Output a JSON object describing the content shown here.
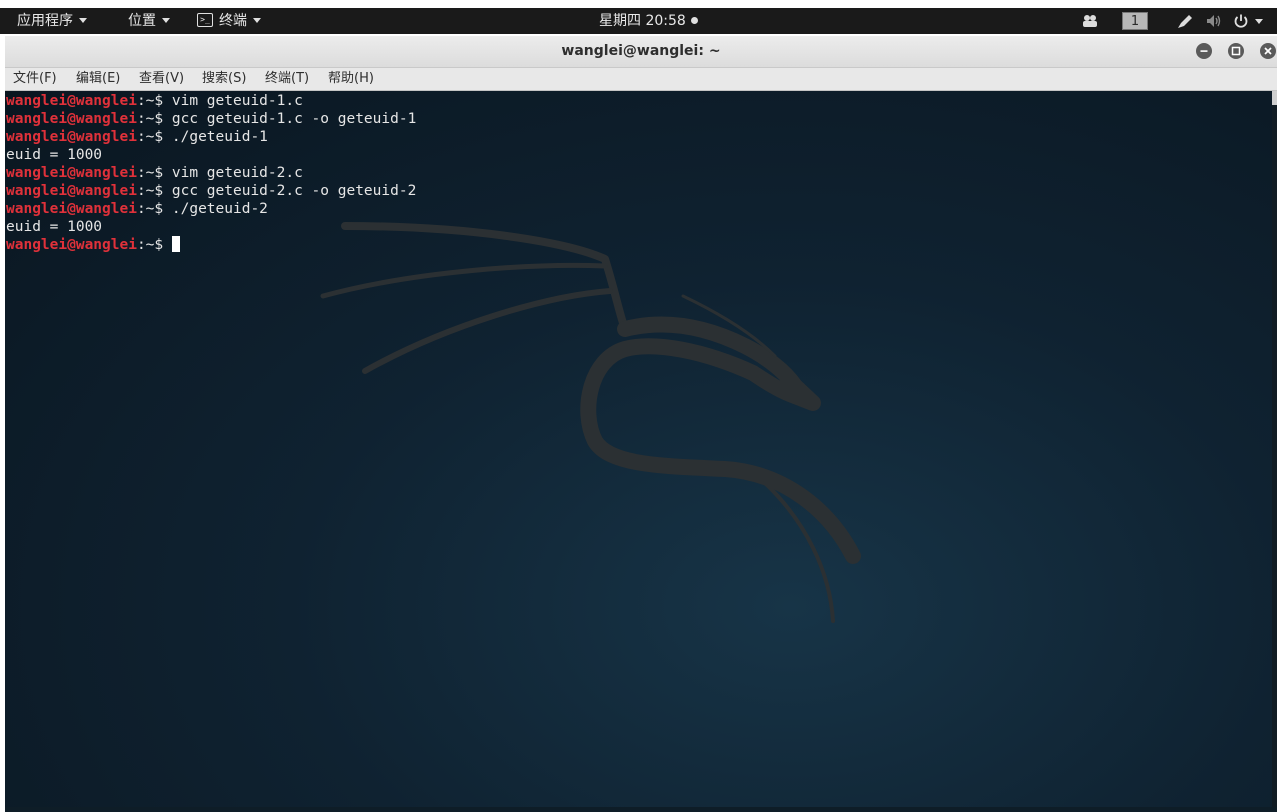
{
  "topbar": {
    "apps_label": "应用程序",
    "places_label": "位置",
    "terminal_label": "终端",
    "clock": "星期四 20:58",
    "workspace": "1"
  },
  "window": {
    "title": "wanglei@wanglei: ~",
    "menu": [
      "文件(F)",
      "编辑(E)",
      "查看(V)",
      "搜索(S)",
      "终端(T)",
      "帮助(H)"
    ]
  },
  "terminal": {
    "prompt_user": "wanglei@wanglei",
    "prompt_suffix": ":~$ ",
    "lines": [
      {
        "type": "prompt",
        "cmd": "vim geteuid-1.c"
      },
      {
        "type": "prompt",
        "cmd": "gcc geteuid-1.c -o geteuid-1"
      },
      {
        "type": "prompt",
        "cmd": "./geteuid-1"
      },
      {
        "type": "output",
        "text": "euid = 1000"
      },
      {
        "type": "prompt",
        "cmd": "vim geteuid-2.c"
      },
      {
        "type": "prompt",
        "cmd": "gcc geteuid-2.c -o geteuid-2"
      },
      {
        "type": "prompt",
        "cmd": "./geteuid-2"
      },
      {
        "type": "output",
        "text": "euid = 1000"
      },
      {
        "type": "prompt",
        "cmd": ""
      }
    ]
  },
  "colors": {
    "prompt": "#e0313a",
    "terminal_bg": "#0f2231",
    "topbar_bg": "#1a1a1a"
  },
  "icons": [
    "terminal-app-icon",
    "people-icon",
    "pen-icon",
    "volume-icon",
    "power-icon",
    "minimize-icon",
    "maximize-icon",
    "close-icon",
    "kali-dragon-logo"
  ]
}
